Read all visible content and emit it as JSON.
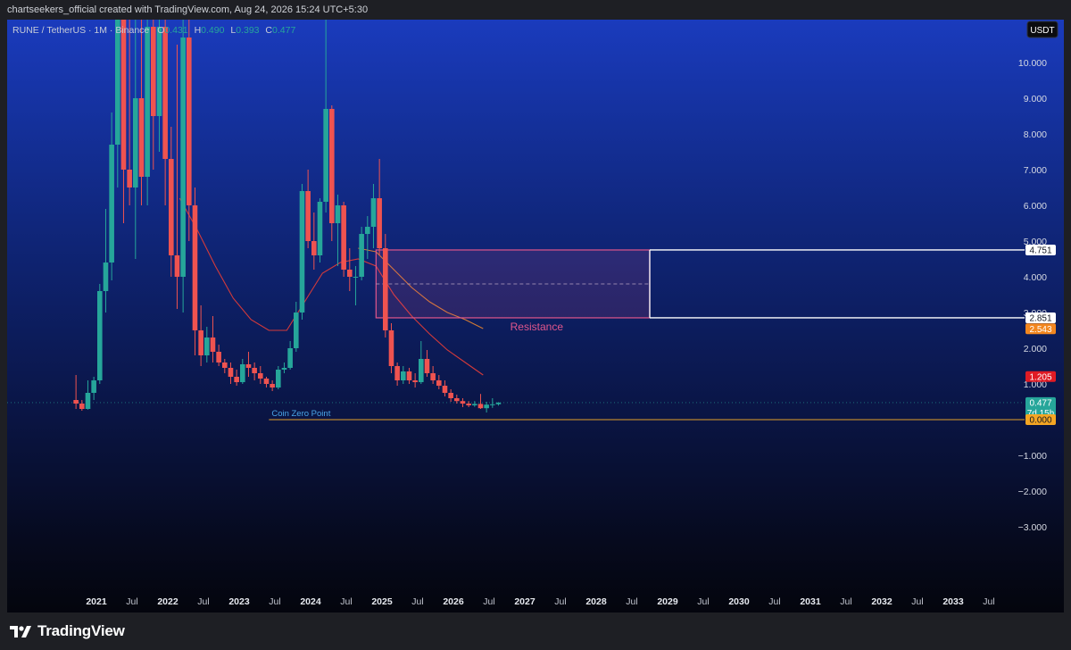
{
  "header": {
    "attribution": "chartseekers_official created with TradingView.com, Aug 24, 2026 15:24 UTC+5:30"
  },
  "legend": {
    "symbol": "RUNE / TetherUS · 1M · Binance",
    "o_label": "O",
    "o_value": "0.431",
    "h_label": "H",
    "h_value": "0.490",
    "l_label": "L",
    "l_value": "0.393",
    "c_label": "C",
    "c_value": "0.477"
  },
  "currency_button": "USDT",
  "footer": {
    "brand": "TradingView"
  },
  "colors": {
    "up": "#26a69a",
    "down": "#ef5350",
    "zone": "#e0568c",
    "white_level": "#ffffff",
    "coin_zero": "#e3a02a",
    "ma_red": "#d43a3a",
    "ma_orange": "#d27a34",
    "price_badge": "#26a69a",
    "red_badge": "#e01b24",
    "orange_badge": "#f3871f",
    "zero_badge": "#f5a623"
  },
  "chart_data": {
    "type": "candlestick",
    "symbol": "RUNE / TetherUS",
    "interval": "1M",
    "exchange": "Binance",
    "y_axis": {
      "scale": "linear",
      "currency": "USDT",
      "ticks": [
        "10.000",
        "9.000",
        "8.000",
        "7.000",
        "6.000",
        "5.000",
        "4.000",
        "3.000",
        "2.000",
        "1.000",
        "−1.000",
        "−2.000",
        "−3.000"
      ],
      "tick_values": [
        10,
        9,
        8,
        7,
        6,
        5,
        4,
        3,
        2,
        1,
        -1,
        -2,
        -3
      ],
      "range": [
        -4.8,
        11.2
      ]
    },
    "x_axis": {
      "ticks": [
        "2021",
        "Jul",
        "2022",
        "Jul",
        "2023",
        "Jul",
        "2024",
        "Jul",
        "2025",
        "Jul",
        "2026",
        "Jul",
        "2027",
        "Jul",
        "2028",
        "Jul",
        "2029",
        "Jul",
        "2030",
        "Jul",
        "2031",
        "Jul",
        "2032",
        "Jul",
        "2033",
        "Jul"
      ],
      "tick_dates": [
        "2021-01",
        "2021-07",
        "2022-01",
        "2022-07",
        "2023-01",
        "2023-07",
        "2024-01",
        "2024-07",
        "2025-01",
        "2025-07",
        "2026-01",
        "2026-07",
        "2027-01",
        "2027-07",
        "2028-01",
        "2028-07",
        "2029-01",
        "2029-07",
        "2030-01",
        "2030-07",
        "2031-01",
        "2031-07",
        "2032-01",
        "2032-07",
        "2033-01",
        "2033-07"
      ],
      "range": [
        "2019-10",
        "2034-01"
      ]
    },
    "candles": [
      {
        "t": "2020-09",
        "o": 0.55,
        "h": 1.25,
        "l": 0.3,
        "c": 0.45
      },
      {
        "t": "2020-10",
        "o": 0.45,
        "h": 0.55,
        "l": 0.25,
        "c": 0.3
      },
      {
        "t": "2020-11",
        "o": 0.3,
        "h": 1.1,
        "l": 0.28,
        "c": 0.75
      },
      {
        "t": "2020-12",
        "o": 0.75,
        "h": 1.2,
        "l": 0.55,
        "c": 1.1
      },
      {
        "t": "2021-01",
        "o": 1.1,
        "h": 3.8,
        "l": 1.0,
        "c": 3.6
      },
      {
        "t": "2021-02",
        "o": 3.6,
        "h": 5.9,
        "l": 3.0,
        "c": 4.4
      },
      {
        "t": "2021-03",
        "o": 4.4,
        "h": 8.6,
        "l": 3.9,
        "c": 7.7
      },
      {
        "t": "2021-04",
        "o": 7.7,
        "h": 20.0,
        "l": 6.5,
        "c": 13.0
      },
      {
        "t": "2021-05",
        "o": 13.0,
        "h": 20.0,
        "l": 5.5,
        "c": 7.0
      },
      {
        "t": "2021-06",
        "o": 7.0,
        "h": 15.0,
        "l": 6.0,
        "c": 6.5
      },
      {
        "t": "2021-07",
        "o": 6.5,
        "h": 12.0,
        "l": 4.5,
        "c": 9.0
      },
      {
        "t": "2021-08",
        "o": 9.0,
        "h": 12.0,
        "l": 6.0,
        "c": 6.8
      },
      {
        "t": "2021-09",
        "o": 6.8,
        "h": 12.0,
        "l": 6.0,
        "c": 11.0
      },
      {
        "t": "2021-10",
        "o": 11.0,
        "h": 20.0,
        "l": 7.0,
        "c": 8.5
      },
      {
        "t": "2021-11",
        "o": 8.5,
        "h": 20.0,
        "l": 7.5,
        "c": 11.0
      },
      {
        "t": "2021-12",
        "o": 11.0,
        "h": 20.0,
        "l": 6.0,
        "c": 7.3
      },
      {
        "t": "2022-01",
        "o": 7.3,
        "h": 8.2,
        "l": 4.0,
        "c": 4.6
      },
      {
        "t": "2022-02",
        "o": 4.6,
        "h": 10.5,
        "l": 3.1,
        "c": 4.0
      },
      {
        "t": "2022-03",
        "o": 4.0,
        "h": 12.0,
        "l": 3.0,
        "c": 10.7
      },
      {
        "t": "2022-04",
        "o": 10.7,
        "h": 12.0,
        "l": 5.0,
        "c": 6.0
      },
      {
        "t": "2022-05",
        "o": 6.0,
        "h": 6.5,
        "l": 1.8,
        "c": 2.5
      },
      {
        "t": "2022-06",
        "o": 2.5,
        "h": 3.2,
        "l": 1.5,
        "c": 1.8
      },
      {
        "t": "2022-07",
        "o": 1.8,
        "h": 2.6,
        "l": 1.6,
        "c": 2.3
      },
      {
        "t": "2022-08",
        "o": 2.3,
        "h": 2.9,
        "l": 1.6,
        "c": 1.9
      },
      {
        "t": "2022-09",
        "o": 1.9,
        "h": 2.1,
        "l": 1.5,
        "c": 1.6
      },
      {
        "t": "2022-10",
        "o": 1.6,
        "h": 1.7,
        "l": 1.3,
        "c": 1.45
      },
      {
        "t": "2022-11",
        "o": 1.45,
        "h": 1.6,
        "l": 1.0,
        "c": 1.2
      },
      {
        "t": "2022-12",
        "o": 1.2,
        "h": 1.4,
        "l": 0.95,
        "c": 1.05
      },
      {
        "t": "2023-01",
        "o": 1.05,
        "h": 1.7,
        "l": 1.0,
        "c": 1.55
      },
      {
        "t": "2023-02",
        "o": 1.55,
        "h": 1.9,
        "l": 1.2,
        "c": 1.45
      },
      {
        "t": "2023-03",
        "o": 1.45,
        "h": 1.6,
        "l": 1.1,
        "c": 1.3
      },
      {
        "t": "2023-04",
        "o": 1.3,
        "h": 1.5,
        "l": 1.0,
        "c": 1.15
      },
      {
        "t": "2023-05",
        "o": 1.15,
        "h": 1.2,
        "l": 0.9,
        "c": 1.0
      },
      {
        "t": "2023-06",
        "o": 1.0,
        "h": 1.1,
        "l": 0.8,
        "c": 0.9
      },
      {
        "t": "2023-07",
        "o": 0.9,
        "h": 1.5,
        "l": 0.85,
        "c": 1.4
      },
      {
        "t": "2023-08",
        "o": 1.4,
        "h": 1.6,
        "l": 1.3,
        "c": 1.45
      },
      {
        "t": "2023-09",
        "o": 1.45,
        "h": 2.2,
        "l": 1.4,
        "c": 2.0
      },
      {
        "t": "2023-10",
        "o": 2.0,
        "h": 3.3,
        "l": 1.9,
        "c": 3.0
      },
      {
        "t": "2023-11",
        "o": 3.0,
        "h": 6.6,
        "l": 2.8,
        "c": 6.4
      },
      {
        "t": "2023-12",
        "o": 6.4,
        "h": 7.0,
        "l": 4.8,
        "c": 5.0
      },
      {
        "t": "2024-01",
        "o": 5.0,
        "h": 5.8,
        "l": 4.2,
        "c": 4.6
      },
      {
        "t": "2024-02",
        "o": 4.6,
        "h": 6.2,
        "l": 4.4,
        "c": 6.1
      },
      {
        "t": "2024-03",
        "o": 6.1,
        "h": 13.0,
        "l": 5.8,
        "c": 8.7
      },
      {
        "t": "2024-04",
        "o": 8.7,
        "h": 8.8,
        "l": 5.0,
        "c": 5.5
      },
      {
        "t": "2024-05",
        "o": 5.5,
        "h": 6.3,
        "l": 4.3,
        "c": 6.0
      },
      {
        "t": "2024-06",
        "o": 6.0,
        "h": 6.1,
        "l": 4.0,
        "c": 4.2
      },
      {
        "t": "2024-07",
        "o": 4.2,
        "h": 4.8,
        "l": 3.6,
        "c": 4.0
      },
      {
        "t": "2024-08",
        "o": 4.0,
        "h": 4.3,
        "l": 3.2,
        "c": 4.0
      },
      {
        "t": "2024-09",
        "o": 4.0,
        "h": 5.4,
        "l": 3.9,
        "c": 5.2
      },
      {
        "t": "2024-10",
        "o": 5.2,
        "h": 5.7,
        "l": 4.5,
        "c": 5.4
      },
      {
        "t": "2024-11",
        "o": 5.4,
        "h": 6.6,
        "l": 4.8,
        "c": 6.2
      },
      {
        "t": "2024-12",
        "o": 6.2,
        "h": 7.3,
        "l": 4.6,
        "c": 4.8
      },
      {
        "t": "2025-01",
        "o": 4.8,
        "h": 5.2,
        "l": 2.3,
        "c": 2.5
      },
      {
        "t": "2025-02",
        "o": 2.5,
        "h": 2.7,
        "l": 1.3,
        "c": 1.5
      },
      {
        "t": "2025-03",
        "o": 1.5,
        "h": 1.6,
        "l": 0.95,
        "c": 1.1
      },
      {
        "t": "2025-04",
        "o": 1.1,
        "h": 1.5,
        "l": 1.0,
        "c": 1.35
      },
      {
        "t": "2025-05",
        "o": 1.35,
        "h": 1.45,
        "l": 1.0,
        "c": 1.1
      },
      {
        "t": "2025-06",
        "o": 1.1,
        "h": 1.3,
        "l": 0.9,
        "c": 1.05
      },
      {
        "t": "2025-07",
        "o": 1.05,
        "h": 2.2,
        "l": 1.0,
        "c": 1.7
      },
      {
        "t": "2025-08",
        "o": 1.7,
        "h": 1.95,
        "l": 1.2,
        "c": 1.3
      },
      {
        "t": "2025-09",
        "o": 1.3,
        "h": 1.5,
        "l": 1.0,
        "c": 1.1
      },
      {
        "t": "2025-10",
        "o": 1.1,
        "h": 1.25,
        "l": 0.85,
        "c": 0.95
      },
      {
        "t": "2025-11",
        "o": 0.95,
        "h": 1.1,
        "l": 0.65,
        "c": 0.75
      },
      {
        "t": "2025-12",
        "o": 0.75,
        "h": 0.85,
        "l": 0.5,
        "c": 0.6
      },
      {
        "t": "2026-01",
        "o": 0.6,
        "h": 0.7,
        "l": 0.45,
        "c": 0.52
      },
      {
        "t": "2026-02",
        "o": 0.52,
        "h": 0.6,
        "l": 0.35,
        "c": 0.45
      },
      {
        "t": "2026-03",
        "o": 0.45,
        "h": 0.52,
        "l": 0.35,
        "c": 0.4
      },
      {
        "t": "2026-04",
        "o": 0.4,
        "h": 0.52,
        "l": 0.36,
        "c": 0.44
      },
      {
        "t": "2026-05",
        "o": 0.44,
        "h": 0.72,
        "l": 0.3,
        "c": 0.32
      },
      {
        "t": "2026-06",
        "o": 0.32,
        "h": 0.5,
        "l": 0.2,
        "c": 0.42
      },
      {
        "t": "2026-07",
        "o": 0.42,
        "h": 0.6,
        "l": 0.33,
        "c": 0.43
      },
      {
        "t": "2026-08",
        "o": 0.431,
        "h": 0.49,
        "l": 0.393,
        "c": 0.477
      }
    ],
    "moving_averages": [
      {
        "color": "#d43a3a",
        "points": [
          [
            "2022-03",
            6.2
          ],
          [
            "2022-06",
            5.3
          ],
          [
            "2022-09",
            4.3
          ],
          [
            "2022-12",
            3.4
          ],
          [
            "2023-03",
            2.8
          ],
          [
            "2023-06",
            2.5
          ],
          [
            "2023-09",
            2.5
          ],
          [
            "2023-12",
            3.3
          ],
          [
            "2024-03",
            4.1
          ],
          [
            "2024-06",
            4.4
          ],
          [
            "2024-09",
            4.5
          ],
          [
            "2024-12",
            4.3
          ],
          [
            "2025-03",
            3.5
          ],
          [
            "2025-06",
            2.9
          ],
          [
            "2025-09",
            2.4
          ],
          [
            "2025-12",
            1.95
          ],
          [
            "2026-03",
            1.6
          ],
          [
            "2026-06",
            1.25
          ]
        ]
      },
      {
        "color": "#d27a34",
        "points": [
          [
            "2024-09",
            4.8
          ],
          [
            "2024-12",
            4.7
          ],
          [
            "2025-03",
            4.2
          ],
          [
            "2025-06",
            3.7
          ],
          [
            "2025-09",
            3.3
          ],
          [
            "2025-12",
            3.0
          ],
          [
            "2026-03",
            2.8
          ],
          [
            "2026-06",
            2.55
          ]
        ]
      }
    ],
    "zone": {
      "label": "Resistance",
      "top": 4.751,
      "bottom": 2.851,
      "mid": 3.8,
      "start": "2024-12",
      "end": "2028-10"
    },
    "horizontal_levels": [
      {
        "label": "Coin Zero Point",
        "value": 0.0,
        "start": "2023-06"
      }
    ],
    "price_labels": [
      {
        "value": 4.751,
        "text": "4.751",
        "style": "white"
      },
      {
        "value": 2.851,
        "text": "2.851",
        "style": "white"
      },
      {
        "value": 2.543,
        "text": "2.543",
        "style": "orange"
      },
      {
        "value": 1.205,
        "text": "1.205",
        "style": "red"
      },
      {
        "value": 0.477,
        "text": "0.477",
        "text2": "7d 15h",
        "style": "green"
      },
      {
        "value": 0.0,
        "text": "0.000",
        "style": "zero"
      }
    ],
    "last_price": 0.477
  }
}
